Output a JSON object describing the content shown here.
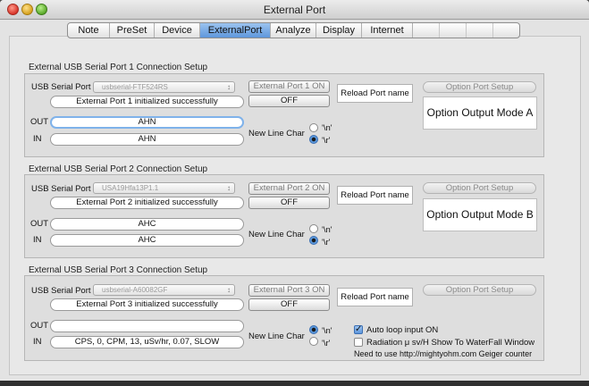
{
  "window": {
    "title": "External Port"
  },
  "tabs": [
    "Note",
    "PreSet",
    "Device",
    "ExternalPort",
    "Analyze",
    "Display",
    "Internet"
  ],
  "active_tab": "ExternalPort",
  "ports": [
    {
      "section_title": "External USB Serial Port 1 Connection Setup",
      "port_label": "USB Serial Port 1",
      "port_value": "usbserial-FTF524RS",
      "on_button": "External Port 1 ON",
      "off_button": "OFF",
      "status": "External Port 1 initialized successfully",
      "reload_label": "Reload Port name",
      "option_setup_label": "Option Port Setup",
      "option_mode": "Option Output Mode A",
      "out_label": "OUT",
      "in_label": "IN",
      "out_value": "AHN",
      "in_value": "AHN",
      "newline_label": "New Line Char",
      "newline_options": [
        "'\\n'",
        "'\\r'"
      ],
      "newline_selected": "'\\r'"
    },
    {
      "section_title": "External USB Serial Port 2 Connection Setup",
      "port_label": "USB Serial Port 2",
      "port_value": "USA19Hfa13P1.1",
      "on_button": "External Port 2 ON",
      "off_button": "OFF",
      "status": "External Port 2 initialized successfully",
      "reload_label": "Reload Port name",
      "option_setup_label": "Option Port Setup",
      "option_mode": "Option Output Mode B",
      "out_label": "OUT",
      "in_label": "IN",
      "out_value": "AHC",
      "in_value": "AHC",
      "newline_label": "New Line Char",
      "newline_options": [
        "'\\n'",
        "'\\r'"
      ],
      "newline_selected": "'\\r'"
    },
    {
      "section_title": "External USB Serial Port 3 Connection Setup",
      "port_label": "USB Serial Port 3",
      "port_value": "usbserial-A60082GF",
      "on_button": "External Port 3 ON",
      "off_button": "OFF",
      "status": "External Port 3 initialized successfully",
      "reload_label": "Reload Port name",
      "option_setup_label": "Option Port Setup",
      "out_label": "OUT",
      "in_label": "IN",
      "out_value": "",
      "in_value": "CPS, 0, CPM, 13, uSv/hr, 0.07, SLOW",
      "newline_label": "New Line Char",
      "newline_options": [
        "'\\n'",
        "'\\r'"
      ],
      "newline_selected": "'\\n'",
      "auto_loop_label": "Auto loop input ON",
      "auto_loop_checked": true,
      "radiation_label": "Radiation μ sv/H Show To WaterFall Window",
      "radiation_checked": false,
      "note": "Need to use http://mightyohm.com Geiger counter"
    }
  ]
}
